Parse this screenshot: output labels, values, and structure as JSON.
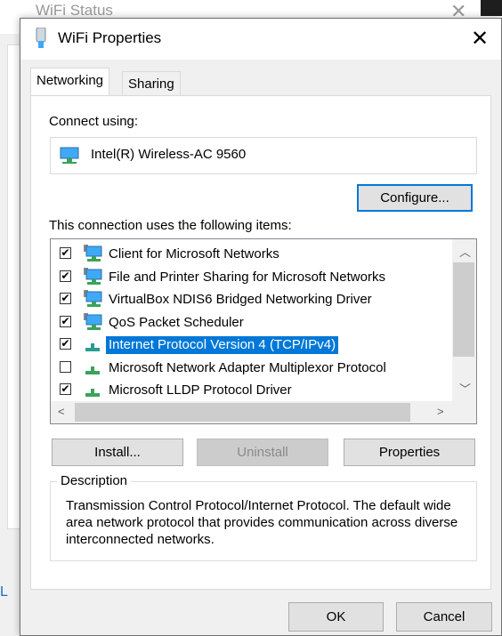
{
  "background_window": {
    "title": "WiFi Status",
    "link_fragment": "L"
  },
  "dialog": {
    "title": "WiFi Properties",
    "tabs": [
      {
        "label": "Networking",
        "active": true
      },
      {
        "label": "Sharing",
        "active": false
      }
    ],
    "connect_using_label": "Connect using:",
    "adapter": "Intel(R) Wireless-AC 9560",
    "configure_label": "Configure...",
    "items_label": "This connection uses the following items:",
    "items": [
      {
        "label": "Client for Microsoft Networks",
        "checked": true,
        "icon": "network-client-icon"
      },
      {
        "label": "File and Printer Sharing for Microsoft Networks",
        "checked": true,
        "icon": "network-service-icon"
      },
      {
        "label": "VirtualBox NDIS6 Bridged Networking Driver",
        "checked": true,
        "icon": "network-service-icon"
      },
      {
        "label": "QoS Packet Scheduler",
        "checked": true,
        "icon": "network-service-icon"
      },
      {
        "label": "Internet Protocol Version 4 (TCP/IPv4)",
        "checked": true,
        "selected": true,
        "icon": "protocol-icon"
      },
      {
        "label": "Microsoft Network Adapter Multiplexor Protocol",
        "checked": false,
        "icon": "protocol-icon"
      },
      {
        "label": "Microsoft LLDP Protocol Driver",
        "checked": true,
        "icon": "protocol-icon"
      }
    ],
    "install_label": "Install...",
    "uninstall_label": "Uninstall",
    "properties_label": "Properties",
    "description_label": "Description",
    "description": "Transmission Control Protocol/Internet Protocol. The default wide area network protocol that provides communication across diverse interconnected networks.",
    "ok_label": "OK",
    "cancel_label": "Cancel",
    "accent": "#0078d7"
  }
}
